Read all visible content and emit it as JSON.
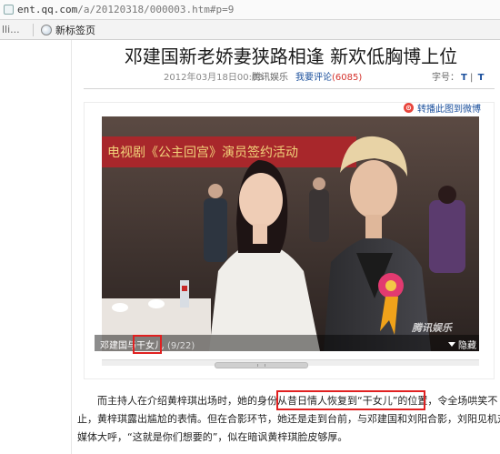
{
  "browser": {
    "url_main": "ent.qq.com",
    "url_rest": "/a/20120318/000003.htm#p=9",
    "fav_cut": "lli...",
    "fav_item": "新标签页"
  },
  "article": {
    "headline": "邓建国新老娇妻狭路相逢  新欢低胸博上位",
    "date": "2012年03月18日00:03",
    "source": "腾讯娱乐",
    "comment_label": "我要评论",
    "comment_count": "(6085)",
    "font_label": "字号：",
    "font_big": "T",
    "font_sep": "|",
    "font_small": "T",
    "weibo_label": "转播此图到微博",
    "photo_banner": "电视剧《公主回宫》演员签约活动",
    "caption": "邓建国与干女儿",
    "caption_page": "(9/22)",
    "watermark": "腾讯娱乐",
    "hide_label": "隐藏",
    "para_lines": [
      "而主持人在介绍黄梓琪出场时，她的身份从昔日情人恢复到“干女儿”的位置，令全场哄笑不",
      "止，黄梓琪露出尴尬的表情。但在合影环节，她还是走到台前，与邓建国和刘阳合影，刘阳见机对",
      "媒体大呼，“这就是你们想要的”，似在暗讽黄梓琪脸皮够厚。"
    ]
  }
}
